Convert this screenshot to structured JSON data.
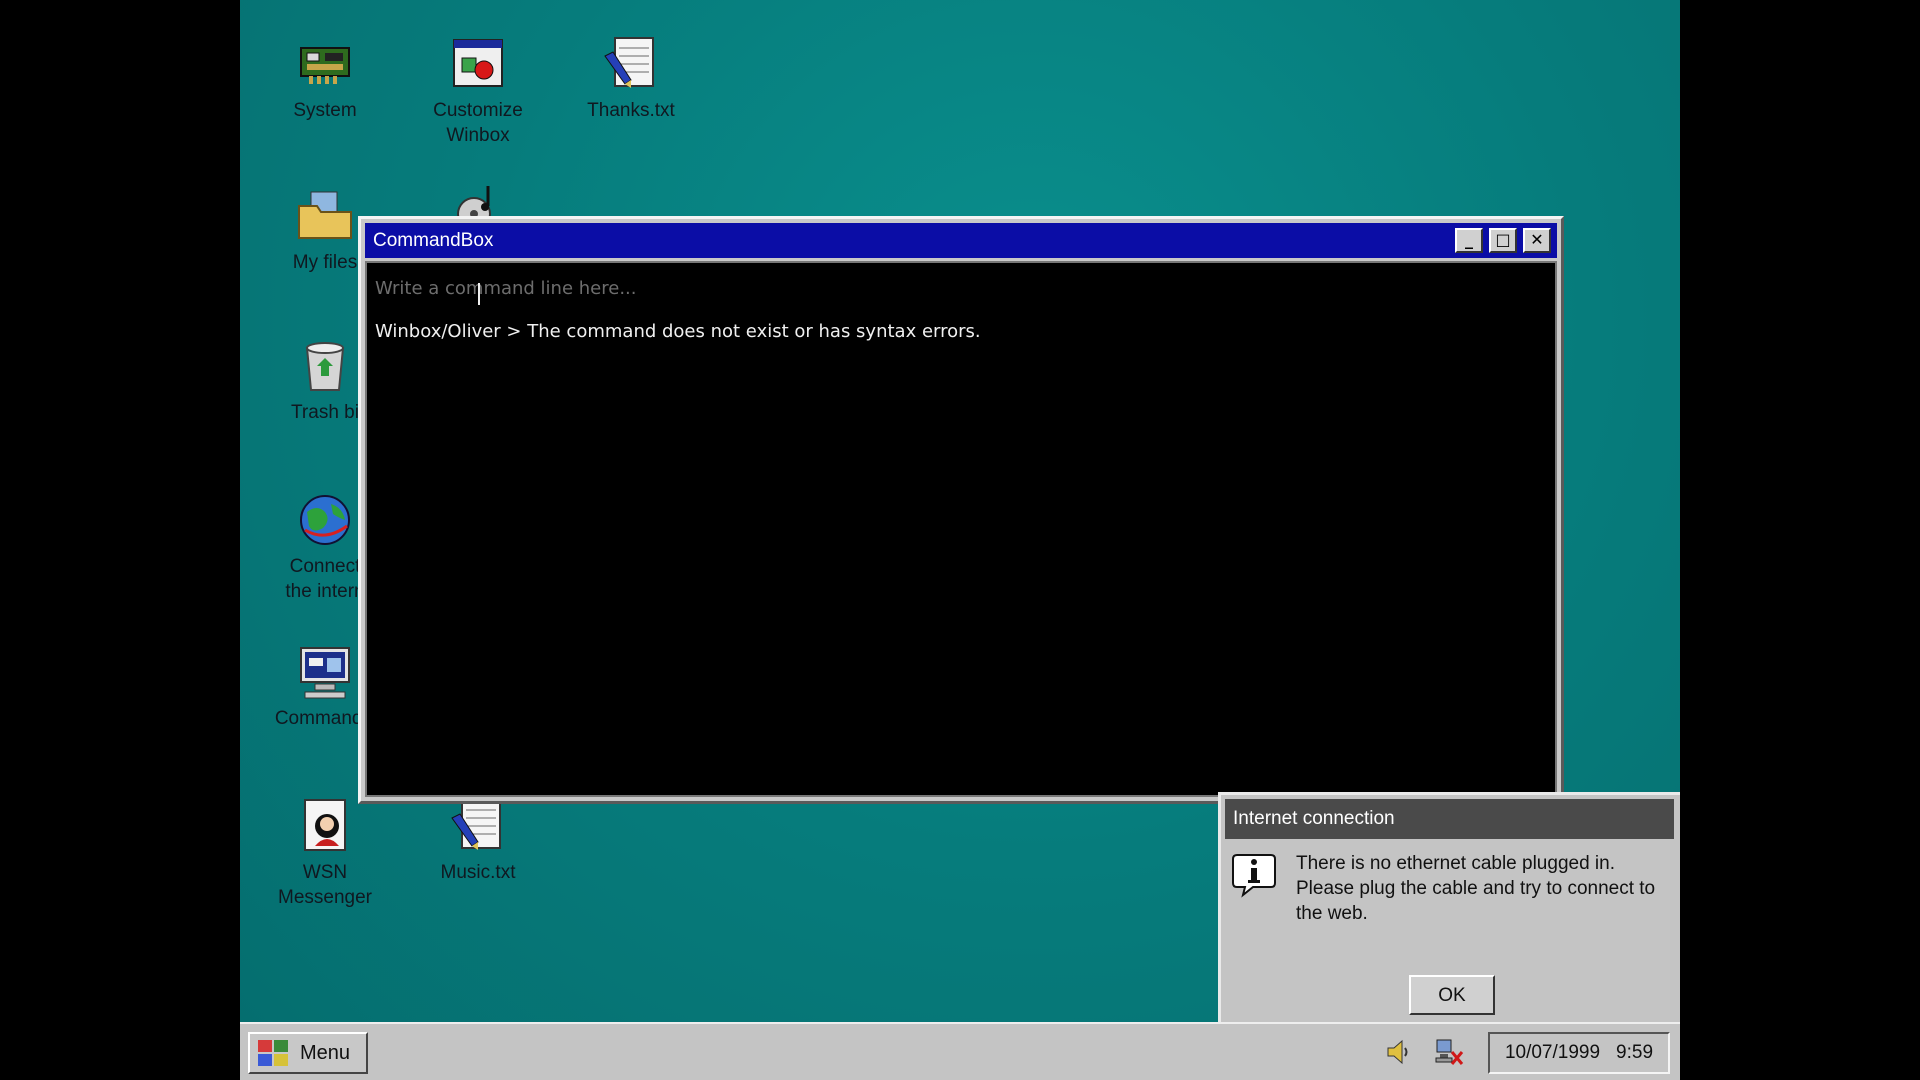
{
  "desktop": {
    "icons": [
      {
        "label": "System",
        "icon": "chip-board-icon"
      },
      {
        "label": "Customize\nWinbox",
        "icon": "customize-window-icon"
      },
      {
        "label": "Thanks.txt",
        "icon": "text-document-icon"
      },
      {
        "label": "My files",
        "icon": "folder-icon"
      },
      {
        "label": "",
        "icon": "music-cd-icon"
      },
      {
        "label": "Trash bi",
        "icon": "trash-bin-icon"
      },
      {
        "label": "Connect\nthe intern",
        "icon": "globe-icon"
      },
      {
        "label": "CommandB",
        "icon": "terminal-computer-icon"
      },
      {
        "label": "WSN\nMessenger",
        "icon": "messenger-icon"
      },
      {
        "label": "Music.txt",
        "icon": "text-document-icon"
      }
    ]
  },
  "command_window": {
    "title": "CommandBox",
    "input_placeholder": "Write a command line here...",
    "input_value": "",
    "output_line": "Winbox/Oliver > The command does not exist or has syntax errors.",
    "buttons": {
      "minimize": "_",
      "maximize": "□",
      "close": "✕"
    }
  },
  "notification": {
    "title": "Internet connection",
    "message": "There is no ethernet cable plugged in. Please plug the cable and try to connect to the web.",
    "ok_label": "OK",
    "icon": "info-icon"
  },
  "taskbar": {
    "menu_label": "Menu",
    "date": "10/07/1999",
    "time": "9:59",
    "tray": [
      "speaker-icon",
      "network-disconnected-icon"
    ]
  },
  "colors": {
    "desktop": "#067c7c",
    "titlebar": "#0b0da6",
    "window_chrome": "#c9c9c9",
    "notification_header": "#4a4a4a"
  }
}
